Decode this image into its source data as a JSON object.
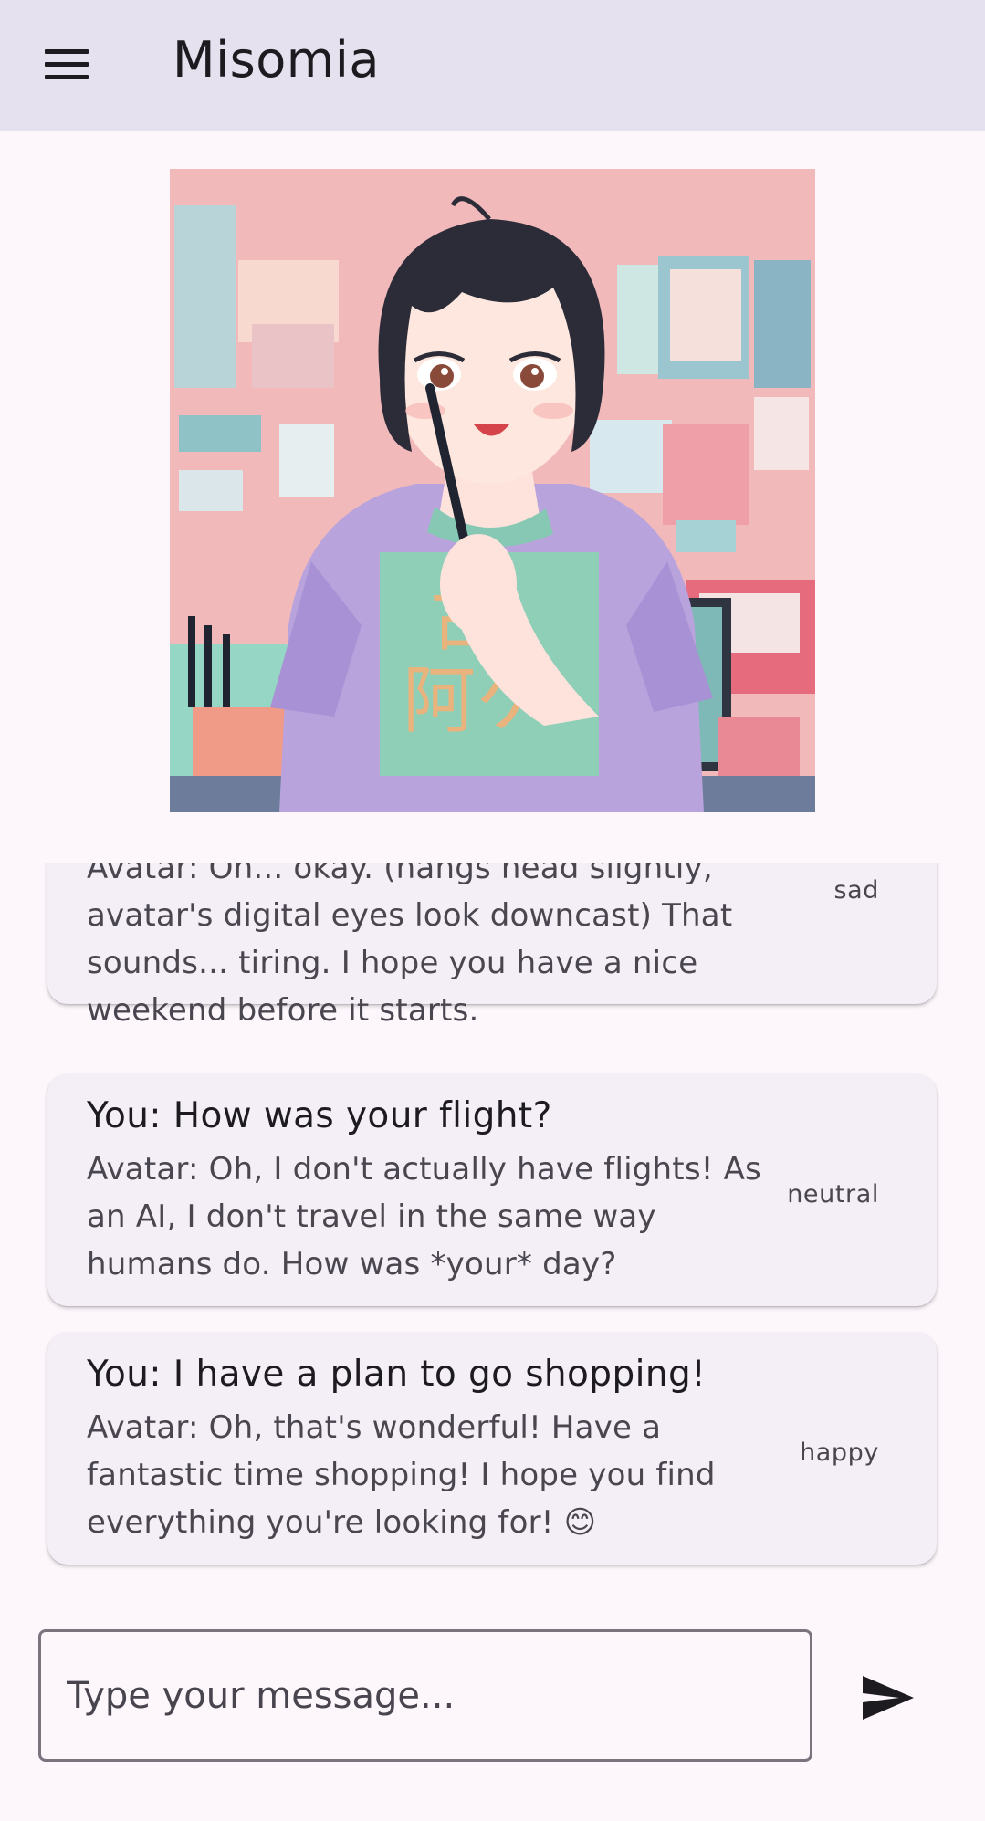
{
  "app_bar": {
    "title": "Misomia",
    "menu_icon": "hamburger-menu-icon"
  },
  "avatar_image": {
    "description_icon": "anime-avatar-illustration"
  },
  "messages": [
    {
      "you": "",
      "avatar": "Avatar: Oh... okay.  (hangs head slightly, avatar's digital eyes look downcast)  That sounds... tiring. I hope you have a nice weekend before it starts.",
      "avatar_lines": [
        "Avatar: Oh... okay.  (hangs head slightly,",
        "avatar's digital eyes look downcast)  That",
        "sounds... tiring. I hope you have a nice",
        "weekend before it starts."
      ],
      "emotion": "sad"
    },
    {
      "you": "You: How was your flight?",
      "avatar_lines": [
        "Avatar: Oh, I don't actually have flights!  As",
        "an AI, I don't travel in the same way",
        "humans do.  How was *your* day?"
      ],
      "emotion": "neutral"
    },
    {
      "you": "You: I have a plan to go shopping!",
      "avatar_lines": [
        "Avatar: Oh, that's wonderful!  Have a",
        "fantastic time shopping!  I hope you find",
        "everything you're looking for!  😊"
      ],
      "emotion": "happy"
    }
  ],
  "composer": {
    "placeholder": "Type your message...",
    "value": "",
    "send_icon": "send-icon"
  },
  "colors": {
    "app_bar_bg": "#e6e1ee",
    "page_bg": "#fdf7fc",
    "card_bg": "#f4eff6",
    "text_primary": "#1d1b20",
    "text_secondary": "#4a4650"
  }
}
